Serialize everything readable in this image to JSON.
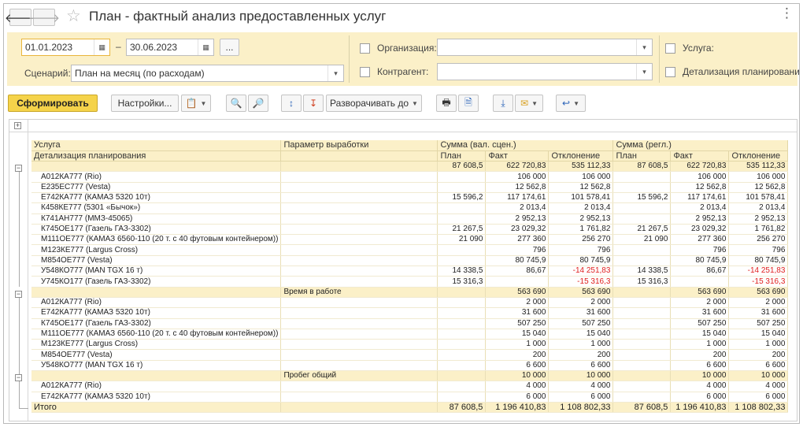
{
  "window": {
    "title": "План - фактный анализ предоставленных услуг",
    "more_label": "⋮"
  },
  "filters": {
    "date_from": "01.01.2023",
    "date_dash": "–",
    "date_to": "30.06.2023",
    "period_button": "...",
    "scenario_label": "Сценарий:",
    "scenario_value": "План на месяц (по расходам)",
    "organization_label": "Организация:",
    "organization_value": "",
    "counterparty_label": "Контрагент:",
    "counterparty_value": "",
    "service_label": "Услуга:",
    "detail_label": "Детализация планирования:"
  },
  "toolbar": {
    "generate": "Сформировать",
    "settings": "Настройки...",
    "expand_to": "Разворачивать до"
  },
  "colors": {
    "accent": "#f5d34a",
    "panel": "#fbf0c8",
    "negative": "#e02020"
  },
  "report": {
    "header1": [
      "Услуга",
      "Параметр выработки",
      "Сумма (вал. сцен.)",
      "Сумма (регл.)"
    ],
    "header2": [
      "Детализация планирования",
      "",
      "План",
      "Факт",
      "Отклонение",
      "План",
      "Факт",
      "Отклонение"
    ],
    "rows": [
      {
        "t": "g",
        "c": [
          "",
          "",
          "87 608,5",
          "622 720,83",
          "535 112,33",
          "87 608,5",
          "622 720,83",
          "535 112,33"
        ]
      },
      {
        "t": "d",
        "c": [
          "А012КА777 (Rio)",
          "",
          "",
          "106 000",
          "106 000",
          "",
          "106 000",
          "106 000"
        ]
      },
      {
        "t": "d",
        "c": [
          "Е235ЕС777 (Vesta)",
          "",
          "",
          "12 562,8",
          "12 562,8",
          "",
          "12 562,8",
          "12 562,8"
        ]
      },
      {
        "t": "d",
        "c": [
          "Е742КА777 (КАМАЗ 5320 10т)",
          "",
          "15 596,2",
          "117 174,61",
          "101 578,41",
          "15 596,2",
          "117 174,61",
          "101 578,41"
        ]
      },
      {
        "t": "d",
        "c": [
          "К458КЕ777 (5301 «Бычок»)",
          "",
          "",
          "2 013,4",
          "2 013,4",
          "",
          "2 013,4",
          "2 013,4"
        ]
      },
      {
        "t": "d",
        "c": [
          "К741АН777 (ММЗ-45065)",
          "",
          "",
          "2 952,13",
          "2 952,13",
          "",
          "2 952,13",
          "2 952,13"
        ]
      },
      {
        "t": "d",
        "c": [
          "К745ОЕ177 (Газель ГАЗ-3302)",
          "",
          "21 267,5",
          "23 029,32",
          "1 761,82",
          "21 267,5",
          "23 029,32",
          "1 761,82"
        ]
      },
      {
        "t": "d",
        "c": [
          "М111ОЕ777 (КАМАЗ 6560-110 (20 т. с 40 футовым контейнером))",
          "",
          "21 090",
          "277 360",
          "256 270",
          "21 090",
          "277 360",
          "256 270"
        ]
      },
      {
        "t": "d",
        "c": [
          "М123КЕ777 (Largus Cross)",
          "",
          "",
          "796",
          "796",
          "",
          "796",
          "796"
        ]
      },
      {
        "t": "d",
        "c": [
          "М854ОЕ777 (Vesta)",
          "",
          "",
          "80 745,9",
          "80 745,9",
          "",
          "80 745,9",
          "80 745,9"
        ]
      },
      {
        "t": "d",
        "c": [
          "У548КО777 (MAN TGX  16 т)",
          "",
          "14 338,5",
          "86,67",
          "-14 251,83",
          "14 338,5",
          "86,67",
          "-14 251,83"
        ],
        "neg": true
      },
      {
        "t": "d",
        "c": [
          "У745КО177 (Газель ГАЗ-3302)",
          "",
          "15 316,3",
          "",
          "-15 316,3",
          "15 316,3",
          "",
          "-15 316,3"
        ],
        "neg": true
      },
      {
        "t": "g",
        "c": [
          "",
          "Время в работе",
          "",
          "563 690",
          "563 690",
          "",
          "563 690",
          "563 690"
        ]
      },
      {
        "t": "d",
        "c": [
          "А012КА777 (Rio)",
          "",
          "",
          "2 000",
          "2 000",
          "",
          "2 000",
          "2 000"
        ]
      },
      {
        "t": "d",
        "c": [
          "Е742КА777 (КАМАЗ 5320 10т)",
          "",
          "",
          "31 600",
          "31 600",
          "",
          "31 600",
          "31 600"
        ]
      },
      {
        "t": "d",
        "c": [
          "К745ОЕ177 (Газель ГАЗ-3302)",
          "",
          "",
          "507 250",
          "507 250",
          "",
          "507 250",
          "507 250"
        ]
      },
      {
        "t": "d",
        "c": [
          "М111ОЕ777 (КАМАЗ 6560-110 (20 т. с 40 футовым контейнером))",
          "",
          "",
          "15 040",
          "15 040",
          "",
          "15 040",
          "15 040"
        ]
      },
      {
        "t": "d",
        "c": [
          "М123КЕ777 (Largus Cross)",
          "",
          "",
          "1 000",
          "1 000",
          "",
          "1 000",
          "1 000"
        ]
      },
      {
        "t": "d",
        "c": [
          "М854ОЕ777 (Vesta)",
          "",
          "",
          "200",
          "200",
          "",
          "200",
          "200"
        ]
      },
      {
        "t": "d",
        "c": [
          "У548КО777 (MAN TGX  16 т)",
          "",
          "",
          "6 600",
          "6 600",
          "",
          "6 600",
          "6 600"
        ]
      },
      {
        "t": "g",
        "c": [
          "",
          "Пробег общий",
          "",
          "10 000",
          "10 000",
          "",
          "10 000",
          "10 000"
        ]
      },
      {
        "t": "d",
        "c": [
          "А012КА777 (Rio)",
          "",
          "",
          "4 000",
          "4 000",
          "",
          "4 000",
          "4 000"
        ]
      },
      {
        "t": "d",
        "c": [
          "Е742КА777 (КАМАЗ 5320 10т)",
          "",
          "",
          "6 000",
          "6 000",
          "",
          "6 000",
          "6 000"
        ]
      }
    ],
    "total": [
      "Итого",
      "",
      "87 608,5",
      "1 196 410,83",
      "1 108 802,33",
      "87 608,5",
      "1 196 410,83",
      "1 108 802,33"
    ]
  }
}
